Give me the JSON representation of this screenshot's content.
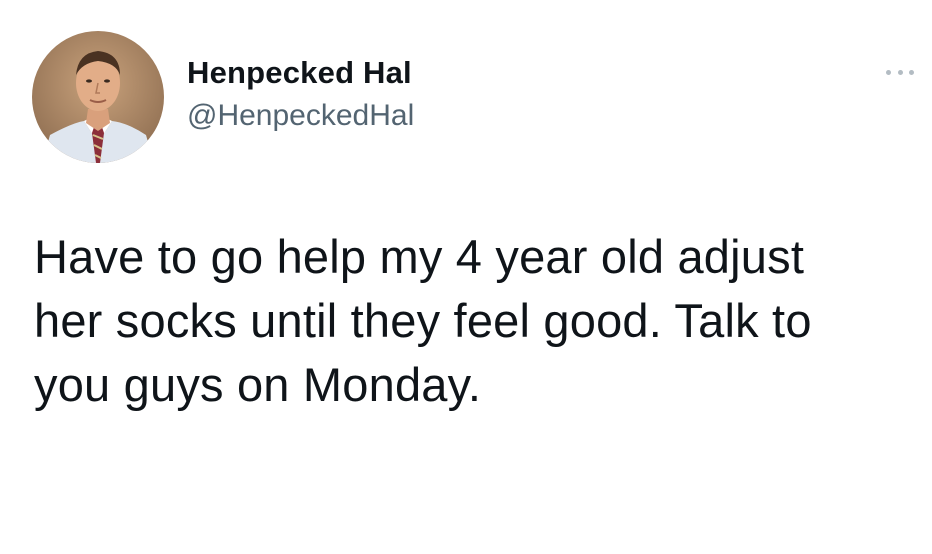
{
  "tweet": {
    "author": {
      "display_name": "Henpecked Hal",
      "handle": "@HenpeckedHal"
    },
    "text": "Have to go help my 4 year old adjust\nher socks until they feel good. Talk to\nyou guys on Monday.",
    "more_icon": "more-horizontal-icon"
  },
  "colors": {
    "text_primary": "#0f1419",
    "text_secondary": "#536471",
    "icon_muted": "#b3bcc3",
    "background": "#ffffff"
  }
}
